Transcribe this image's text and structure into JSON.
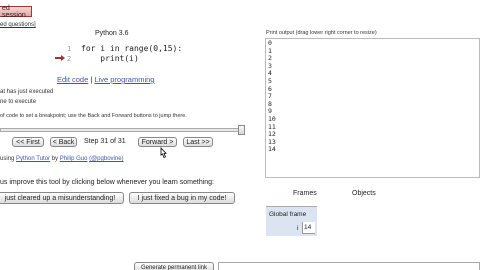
{
  "header": {
    "session_button": "ed session",
    "faq_link": "ed questions]"
  },
  "code_panel": {
    "language": "Python 3.6",
    "lines": [
      {
        "num": "1",
        "text": "for i in range(0,15):"
      },
      {
        "num": "2",
        "text": "    print(i)"
      }
    ],
    "edit_code": "Edit code",
    "separator": "|",
    "live_programming": "Live programming"
  },
  "legend": {
    "line_executed": "at has just executed",
    "line_next": "ne to execute",
    "breakpoint_hint": "of code to set a breakpoint; use the Back and Forward buttons to jump there."
  },
  "navigation": {
    "first": "<< First",
    "back": "< Back",
    "step_text": "Step 31 of 31",
    "forward": "Forward >",
    "last": "Last >>"
  },
  "credits": {
    "prefix": "using",
    "tool": "Python Tutor",
    "by": "by",
    "author": "Philip Guo",
    "handle": "(@pgbovine)"
  },
  "feedback": {
    "prompt": "us improve this tool by clicking below whenever you learn something:",
    "misunderstanding_button": "just cleared up a misunderstanding!",
    "bug_button": "I just fixed a bug in my code!"
  },
  "print_output": {
    "label": "Print output (drag lower right corner to resize)",
    "lines": [
      "0",
      "1",
      "2",
      "3",
      "4",
      "5",
      "6",
      "7",
      "8",
      "9",
      "10",
      "11",
      "12",
      "13",
      "14"
    ]
  },
  "frames": {
    "frames_label": "Frames",
    "objects_label": "Objects",
    "global_frame_label": "Global frame",
    "variable_name": "i",
    "variable_value": "14"
  },
  "permalink": {
    "button": "Generate permanent link"
  },
  "colors": {
    "arrow": "#a33333",
    "link": "#3d58a8",
    "frame_bg": "#dbe4f0"
  }
}
